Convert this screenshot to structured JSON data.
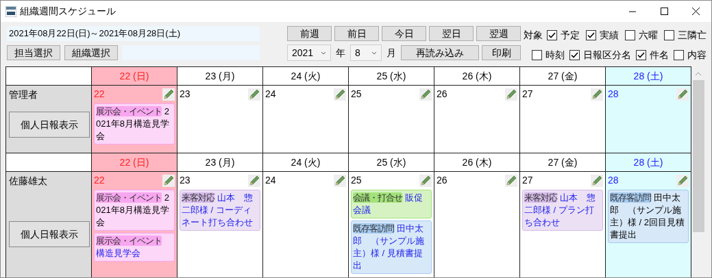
{
  "window": {
    "title": "組織週間スケジュール"
  },
  "range_field": {
    "value": "2021年08月22日(日)～2021年08月28日(土)"
  },
  "nav_buttons": [
    "前週",
    "前日",
    "今日",
    "翌日",
    "翌週"
  ],
  "select_buttons": [
    "担当選択",
    "組織選択"
  ],
  "year_select": {
    "value": "2021"
  },
  "year_label": "年",
  "month_select": {
    "value": "8"
  },
  "month_label": "月",
  "action_buttons": [
    "再読み込み",
    "印刷"
  ],
  "filter_label": "対象",
  "filters": [
    {
      "label": "予定",
      "checked": true
    },
    {
      "label": "実績",
      "checked": true
    },
    {
      "label": "六曜",
      "checked": false
    },
    {
      "label": "三隣亡",
      "checked": false
    },
    {
      "label": "時刻",
      "checked": false
    },
    {
      "label": "日報区分名",
      "checked": true
    },
    {
      "label": "件名",
      "checked": true
    },
    {
      "label": "内容",
      "checked": false
    }
  ],
  "staff": [
    {
      "name": "管理者",
      "button": "個人日報表示",
      "days": [
        {
          "header": "22 (日)",
          "number": "22",
          "kind": "sunday",
          "events": [
            {
              "category": "展示会・イベント",
              "color": "#f8a6ef",
              "title": "2021年8月構造見学会",
              "linked": false
            }
          ]
        },
        {
          "header": "23 (月)",
          "number": "23",
          "kind": "weekday"
        },
        {
          "header": "24 (火)",
          "number": "24",
          "kind": "weekday"
        },
        {
          "header": "25 (水)",
          "number": "25",
          "kind": "weekday"
        },
        {
          "header": "26 (木)",
          "number": "26",
          "kind": "weekday"
        },
        {
          "header": "27 (金)",
          "number": "27",
          "kind": "weekday"
        },
        {
          "header": "28 (土)",
          "number": "28",
          "kind": "saturday"
        }
      ]
    },
    {
      "name": "佐藤雄太",
      "button": "個人日報表示",
      "days": [
        {
          "header": "22 (日)",
          "number": "22",
          "kind": "sunday",
          "events": [
            {
              "category": "展示会・イベント",
              "color": "#f8a6ef",
              "title": "2021年8月構造見学会",
              "linked": false
            },
            {
              "category": "展示会・イベント",
              "color": "#f8a6ef",
              "title": "構造見学会",
              "linked": true
            }
          ]
        },
        {
          "header": "23 (月)",
          "number": "23",
          "kind": "weekday",
          "events": [
            {
              "category": "来客対応",
              "color": "#d4bae8",
              "title": "山本　惣二郎様 / コーディネート打ち合わせ",
              "linked": true
            }
          ]
        },
        {
          "header": "24 (火)",
          "number": "24",
          "kind": "weekday"
        },
        {
          "header": "25 (水)",
          "number": "25",
          "kind": "weekday",
          "events": [
            {
              "category": "会議・打合せ",
              "color": "#a3e27a",
              "title": "販促会議",
              "linked": true
            },
            {
              "category": "既存客訪問",
              "color": "#a6cbf0",
              "title": "田中太郎　（サンプル施主）様 / 見積書提出",
              "linked": true
            }
          ]
        },
        {
          "header": "26 (木)",
          "number": "26",
          "kind": "weekday"
        },
        {
          "header": "27 (金)",
          "number": "27",
          "kind": "weekday",
          "events": [
            {
              "category": "来客対応",
              "color": "#d4bae8",
              "title": "山本　惣二郎様 / プラン打ち合わせ",
              "linked": true
            }
          ]
        },
        {
          "header": "28 (土)",
          "number": "28",
          "kind": "saturday",
          "events": [
            {
              "category": "既存客訪問",
              "color": "#a6cbf0",
              "title": "田中太郎　（サンプル施主）様 / 2回目見積書提出",
              "linked": false
            }
          ]
        }
      ]
    }
  ]
}
